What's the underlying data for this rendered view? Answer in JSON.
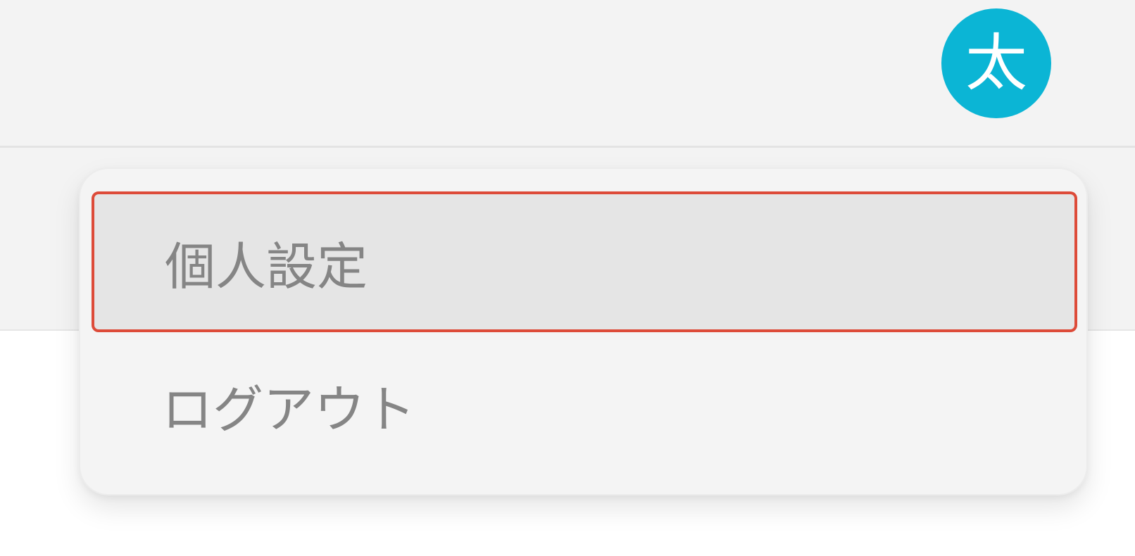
{
  "theme": {
    "avatar_color": "#0bb5d5",
    "highlight_border_color": "#dd4b39"
  },
  "header": {
    "avatar": {
      "initial": "太"
    }
  },
  "dropdown": {
    "items": [
      {
        "label": "個人設定"
      },
      {
        "label": "ログアウト"
      }
    ]
  }
}
